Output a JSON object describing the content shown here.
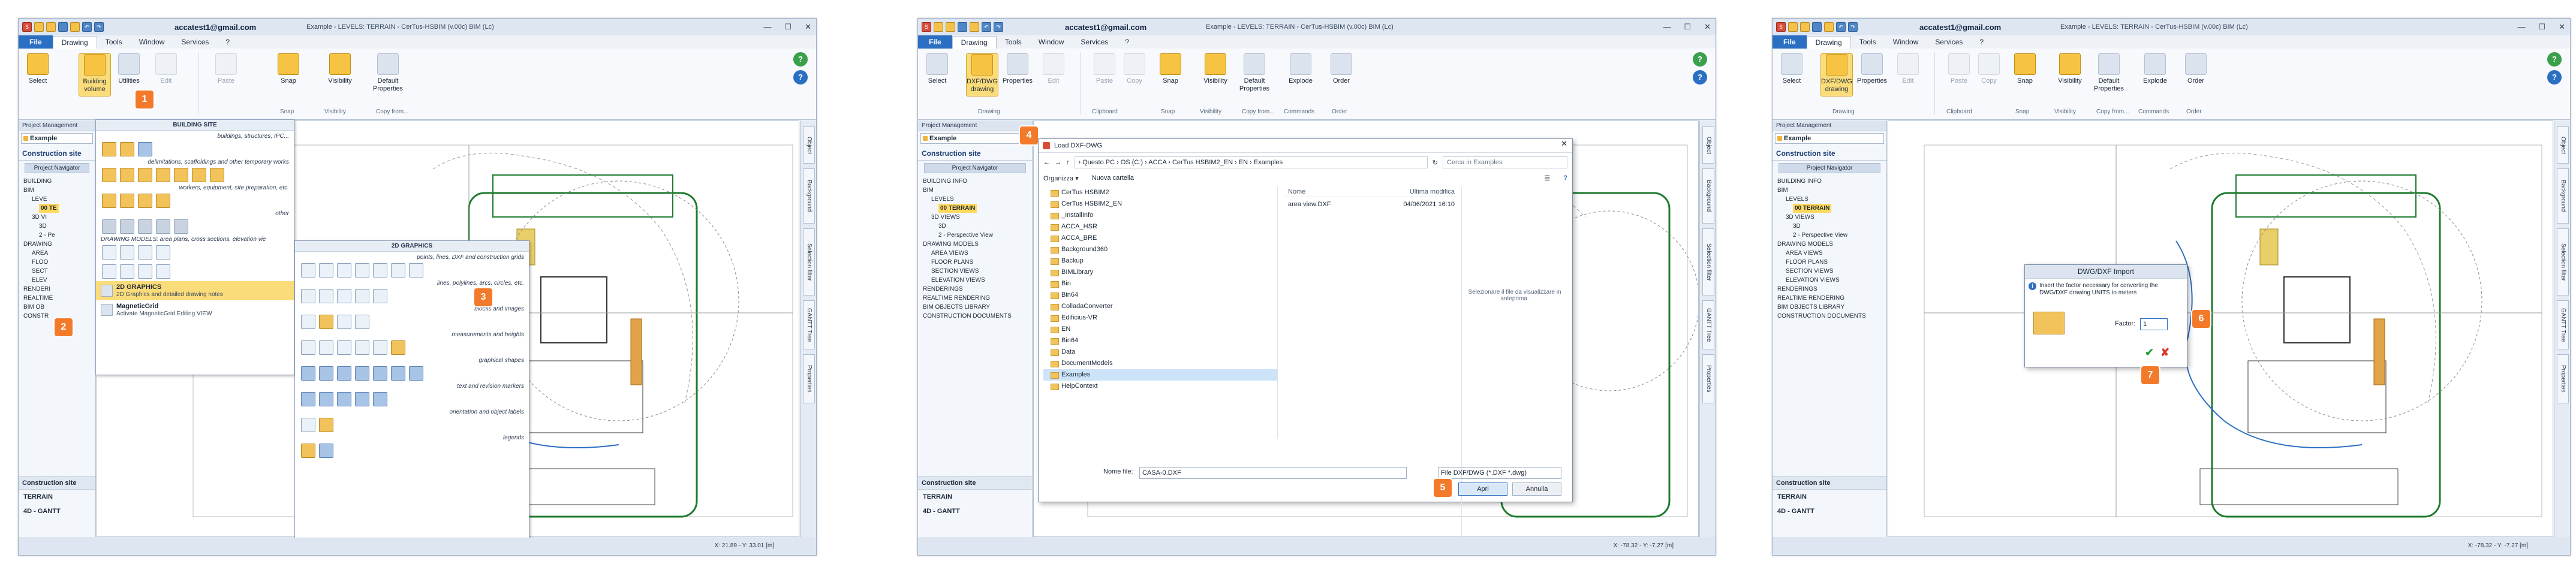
{
  "app": {
    "account": "accatest1@gmail.com",
    "title_1": "Example - LEVELS: TERRAIN - CerTus-HSBIM (v.00c) BIM (Lc)",
    "title_2": "Example - LEVELS: TERRAIN - CerTus-HSBIM (v.00c) BIM (Lc)",
    "title_3": "Example - LEVELS: TERRAIN - CerTus-HSBIM (v.00c) BIM (Lc)",
    "menu": [
      "File",
      "Drawing",
      "Tools",
      "Window",
      "Services",
      "?"
    ]
  },
  "ribbon1": {
    "select": "Select",
    "building": "Building volume",
    "utilities": "Utilities",
    "edit": "Edit",
    "paste": "Paste",
    "snap": "Snap",
    "visibility": "Visibility",
    "default": "Default Properties",
    "copy": "Copy from...",
    "groups": [
      "Snap",
      "Visibility",
      "Copy from..."
    ]
  },
  "ribbon2": {
    "select": "Select",
    "dxf": "DXF/DWG drawing",
    "properties": "Properties",
    "edit": "Edit",
    "paste": "Paste",
    "copy": "Copy",
    "snap": "Snap",
    "visibility": "Visibility",
    "default": "Default Properties",
    "explode": "Explode",
    "order": "Order",
    "groups": [
      "Drawing",
      "Clipboard",
      "Snap",
      "Visibility",
      "Copy from...",
      "Commands",
      "Order"
    ]
  },
  "panel": {
    "title": "Project Management",
    "combo": "Example",
    "section": "Construction site",
    "navigator": "Project Navigator",
    "tree_full": [
      "BUILDING INFO",
      "BIM",
      "LEVELS",
      "00 TERRAIN",
      "3D VIEWS",
      "3D",
      "2 - Perspective View",
      "DRAWING MODELS",
      "AREA VIEWS",
      "FLOOR PLANS",
      "SECTION VIEWS",
      "ELEVATION VIEWS",
      "RENDERINGS",
      "REALTIME RENDERING",
      "BIM OBJECTS LIBRARY",
      "CONSTRUCTION DOCUMENTS"
    ],
    "tree_short": [
      "BUILDING",
      "BIM",
      "LEVE",
      "00 TE",
      "3D VI",
      "3D",
      "2 - Pe",
      "DRAWING",
      "AREA",
      "FLOO",
      "SECT",
      "ELEV",
      "RENDERI",
      "REALTIME",
      "BIM OB",
      "CONSTR"
    ],
    "bottom_title": "Construction site",
    "terrain": "TERRAIN",
    "gantt": "4D - GANTT"
  },
  "rightstrip": [
    "Object",
    "Background",
    "Selection filter",
    "GANTT Tree",
    "Properties"
  ],
  "menu1": {
    "header": "BUILDING SITE",
    "captions": [
      "buildings, structures, IPC...",
      "delimitations, scaffoldings and other temporary works",
      "workers, equipment, site preparation, etc.",
      "other"
    ],
    "drawing_models": "DRAWING MODELS: area plans, cross sections, elevation vie",
    "item1_title": "2D GRAPHICS",
    "item1_sub": "2D Graphics and detailed drawing notes",
    "item2_title": "MagneticGrid",
    "item2_sub": "Activate MagneticGrid Editing VIEW"
  },
  "menu2": {
    "header": "2D GRAPHICS",
    "captions": [
      "points, lines, DXF and construction grids",
      "lines, polylines, arcs, circles, etc.",
      "blocks and images",
      "measurements and heights",
      "graphical shapes",
      "text and revision markers",
      "orientation and object labels",
      "legends"
    ]
  },
  "load": {
    "title": "Load DXF-DWG",
    "path": "› Questo PC › OS (C:) › ACCA › CerTus HSBIM2_EN › EN › Examples",
    "search": "Cerca in Examples",
    "organize": "Organizza ▾",
    "new_folder": "Nuova cartella",
    "folders": [
      "CerTus HSBIM2",
      "CerTus HSBIM2_EN",
      "_InstallInfo",
      "ACCA_HSR",
      "ACCA_BRE",
      "Background360",
      "Backup",
      "BIMLibrary",
      "Bin",
      "Bin64",
      "ColladaConverter",
      "Edificius-VR",
      "EN",
      "Bin64",
      "Data",
      "DocumentModels",
      "Examples",
      "HelpContext"
    ],
    "col_name": "Nome",
    "col_date": "Ultima modifica",
    "file_name": "area view.DXF",
    "file_date": "04/06/2021 16:10",
    "preview": "Selezionare il file da visualizzare in anteprima.",
    "filename_label": "Nome file:",
    "filename_value": "CASA-0.DXF",
    "filetype": "File DXF/DWG (*.DXF *.dwg)",
    "open": "Apri",
    "cancel": "Annulla"
  },
  "import": {
    "title": "DWG/DXF Import",
    "message": "Insert the factor necessary for converting the DWG/DXF drawing UNITS to meters",
    "factor_label": "Factor:",
    "factor_value": "1"
  },
  "status": {
    "coords1": "X: 21.89 - Y: 33.01 [m]",
    "coords2": "X: -78.32 - Y: -7.27 [m]",
    "coords3": "X: -78.32 - Y: -7.27 [m]"
  },
  "callouts": [
    "1",
    "2",
    "3",
    "4",
    "5",
    "6",
    "7"
  ],
  "colors": {
    "accent": "#2a6fc2",
    "callout": "#f37a2b",
    "highlight": "#fbdc7a"
  }
}
